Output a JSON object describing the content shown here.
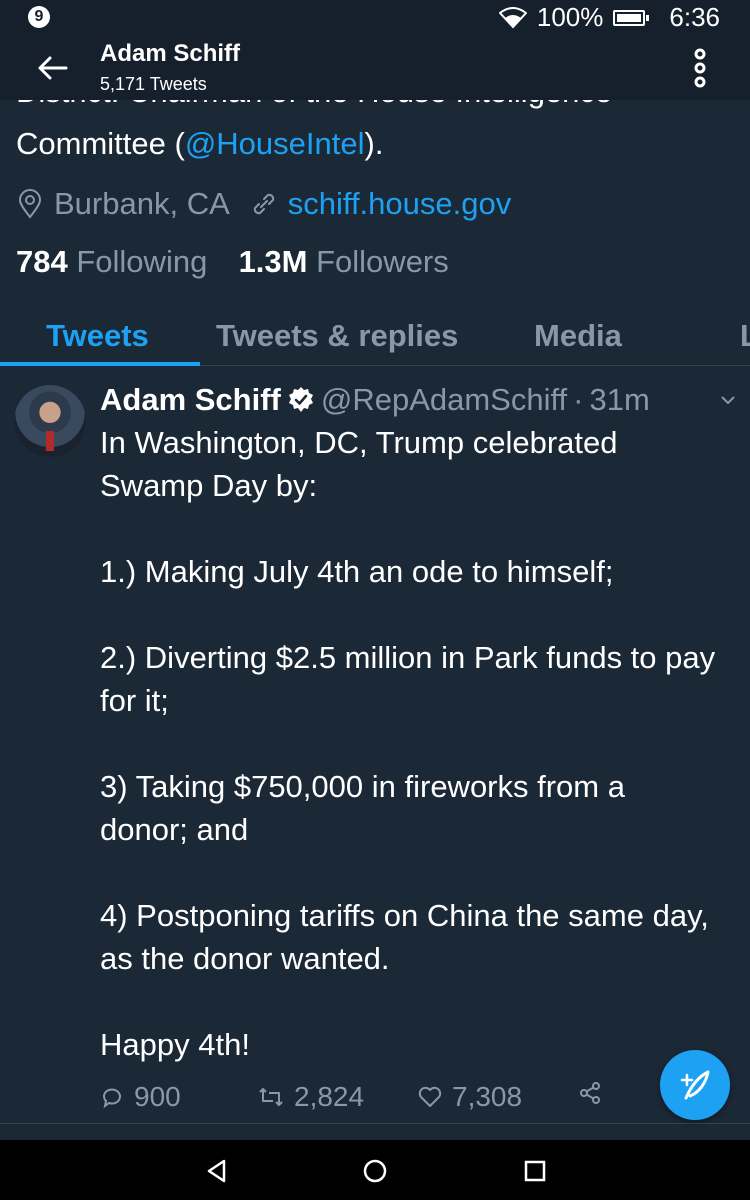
{
  "status_bar": {
    "notification_count": "9",
    "battery": "100%",
    "time": "6:36"
  },
  "app_bar": {
    "title": "Adam Schiff",
    "subtitle": "5,171 Tweets"
  },
  "profile": {
    "bio_clipped": "District. Chairman of the House Intelligence",
    "bio_line_prefix": "Committee (",
    "bio_mention": "@HouseIntel",
    "bio_line_suffix": ").",
    "location": "Burbank, CA",
    "website": "schiff.house.gov",
    "following_count": "784",
    "following_label": "Following",
    "followers_count": "1.3M",
    "followers_label": "Followers"
  },
  "tabs": [
    {
      "label": "Tweets",
      "active": true
    },
    {
      "label": "Tweets & replies",
      "active": false
    },
    {
      "label": "Media",
      "active": false
    },
    {
      "label": "L",
      "active": false
    }
  ],
  "tweet": {
    "name": "Adam Schiff",
    "handle": "@RepAdamSchiff",
    "dot": "·",
    "time": "31m",
    "paragraphs": [
      "In Washington, DC, Trump celebrated Swamp Day by:",
      "1.) Making July 4th an ode to himself;",
      "2.) Diverting $2.5 million in Park funds to pay for it;",
      "3) Taking $750,000 in fireworks from a donor; and",
      "4) Postponing tariffs on China the same day, as the donor wanted.",
      "Happy 4th!"
    ],
    "replies": "900",
    "retweets": "2,824",
    "likes": "7,308"
  },
  "colors": {
    "background": "#1b2836",
    "accent": "#1da1f2",
    "muted": "#8899a6"
  }
}
